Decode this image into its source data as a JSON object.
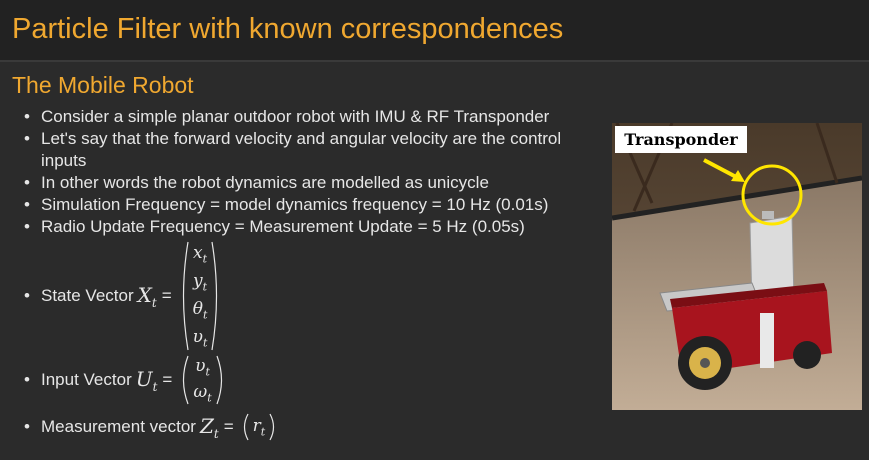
{
  "title": "Particle Filter with known correspondences",
  "subtitle": "The Mobile Robot",
  "bullets": [
    "Consider a simple planar outdoor robot with IMU & RF Transponder",
    "Let's say that the forward velocity and angular velocity are the control inputs",
    "In other words the robot dynamics are modelled as unicycle",
    "Simulation Frequency = model dynamics frequency = 10 Hz (0.01s)",
    "Radio Update Frequency = Measurement Update = 5 Hz (0.05s)"
  ],
  "state_vector": {
    "label": "State Vector",
    "symbol": "X",
    "sub": "t",
    "equals": "=",
    "entries": [
      {
        "base": "x",
        "sub": "t"
      },
      {
        "base": "y",
        "sub": "t"
      },
      {
        "base": "θ",
        "sub": "t"
      },
      {
        "base": "υ",
        "sub": "t"
      }
    ]
  },
  "input_vector": {
    "label": "Input Vector",
    "symbol": "U",
    "sub": "t",
    "equals": "=",
    "entries": [
      {
        "base": "υ",
        "sub": "t"
      },
      {
        "base": "ω",
        "sub": "t"
      }
    ]
  },
  "measurement_vector": {
    "label": "Measurement vector",
    "symbol": "Z",
    "sub": "t",
    "equals": "=",
    "entries": [
      {
        "base": "r",
        "sub": "t"
      }
    ]
  },
  "image": {
    "caption": "Transponder",
    "highlight_color": "#ffe600"
  },
  "colors": {
    "accent": "#f0a830",
    "background": "#2b2b2b",
    "title_bar": "#222222",
    "text": "#e6e6e6"
  }
}
